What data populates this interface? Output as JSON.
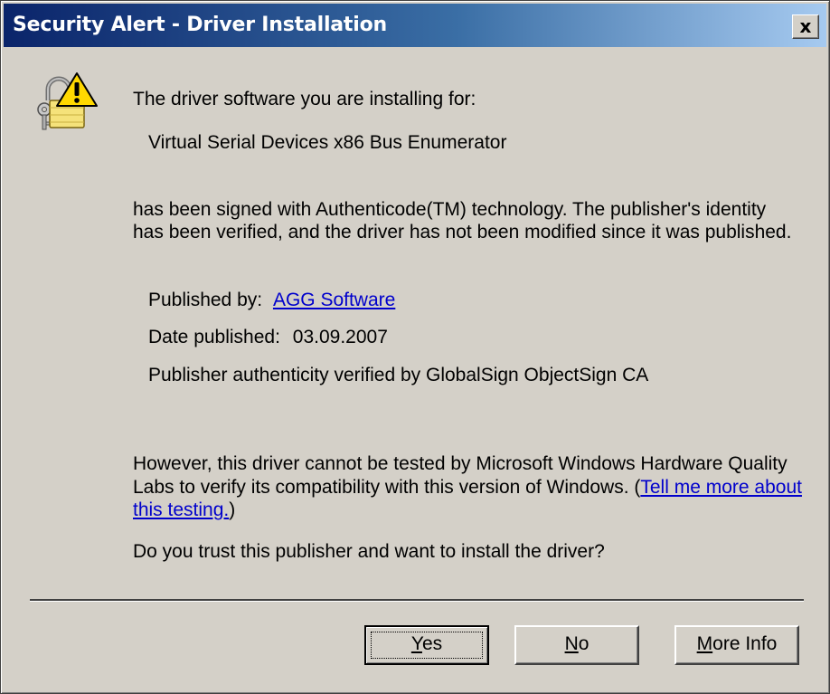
{
  "window": {
    "title": "Security Alert - Driver Installation",
    "close_label": "x"
  },
  "content": {
    "intro": "The driver software you are installing for:",
    "device": "Virtual Serial Devices x86 Bus Enumerator",
    "signed_line1": "has been signed with Authenticode(TM) technology. The publisher's identity",
    "signed_line2": "has been verified, and the driver has not been modified since it was published.",
    "published_by_label": "Published by:",
    "publisher": "AGG Software",
    "date_label": "Date published:",
    "date": "03.09.2007",
    "verified_by": "Publisher authenticity verified by GlobalSign ObjectSign CA",
    "warning_line1": "However, this driver cannot be tested by Microsoft Windows Hardware Quality",
    "warning_line2_prefix": "Labs to verify its compatibility with this version of Windows. (",
    "tell_me_link_part1": "Tell me more about",
    "tell_me_link_part2": "this testing.",
    "warning_line3_suffix": ")",
    "question": "Do you trust this publisher and want to install the driver?"
  },
  "buttons": {
    "yes": {
      "mnemonic": "Y",
      "rest": "es"
    },
    "no": {
      "mnemonic": "N",
      "rest": "o"
    },
    "more_info": {
      "mnemonic": "M",
      "rest": "ore Info"
    }
  },
  "icons": {
    "alert": "warning-lock-icon"
  }
}
